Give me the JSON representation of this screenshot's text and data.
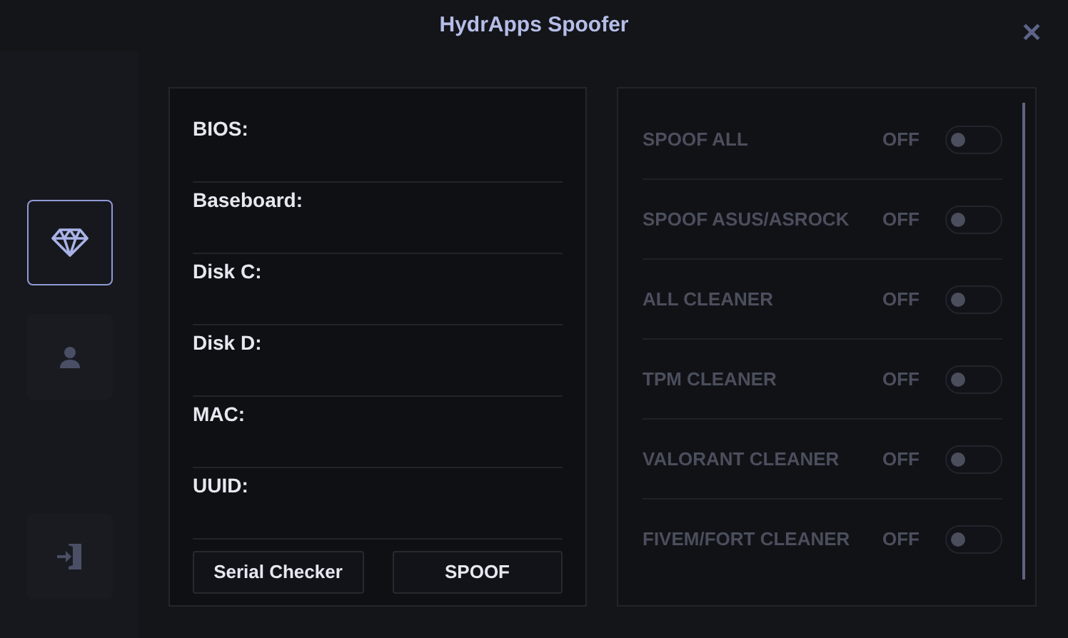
{
  "window": {
    "title": "HydrApps Spoofer",
    "close": "✕"
  },
  "sidebar": {
    "items": [
      {
        "kind": "diamond",
        "selected": true
      },
      {
        "kind": "user",
        "selected": false
      },
      {
        "kind": "exit",
        "selected": false
      }
    ]
  },
  "info": {
    "fields": [
      {
        "label": "BIOS:"
      },
      {
        "label": "Baseboard:"
      },
      {
        "label": "Disk C:"
      },
      {
        "label": "Disk D:"
      },
      {
        "label": "MAC:"
      },
      {
        "label": "UUID:"
      }
    ],
    "buttons": [
      "Serial Checker",
      "SPOOF"
    ]
  },
  "options": [
    {
      "label": "SPOOF ALL",
      "state": "OFF",
      "on": false
    },
    {
      "label": "SPOOF ASUS/ASROCK",
      "state": "OFF",
      "on": false
    },
    {
      "label": "ALL CLEANER",
      "state": "OFF",
      "on": false
    },
    {
      "label": "TPM CLEANER",
      "state": "OFF",
      "on": false
    },
    {
      "label": "VALORANT CLEANER",
      "state": "OFF",
      "on": false
    },
    {
      "label": "FIVEM/FORT CLEANER",
      "state": "OFF",
      "on": false
    }
  ]
}
